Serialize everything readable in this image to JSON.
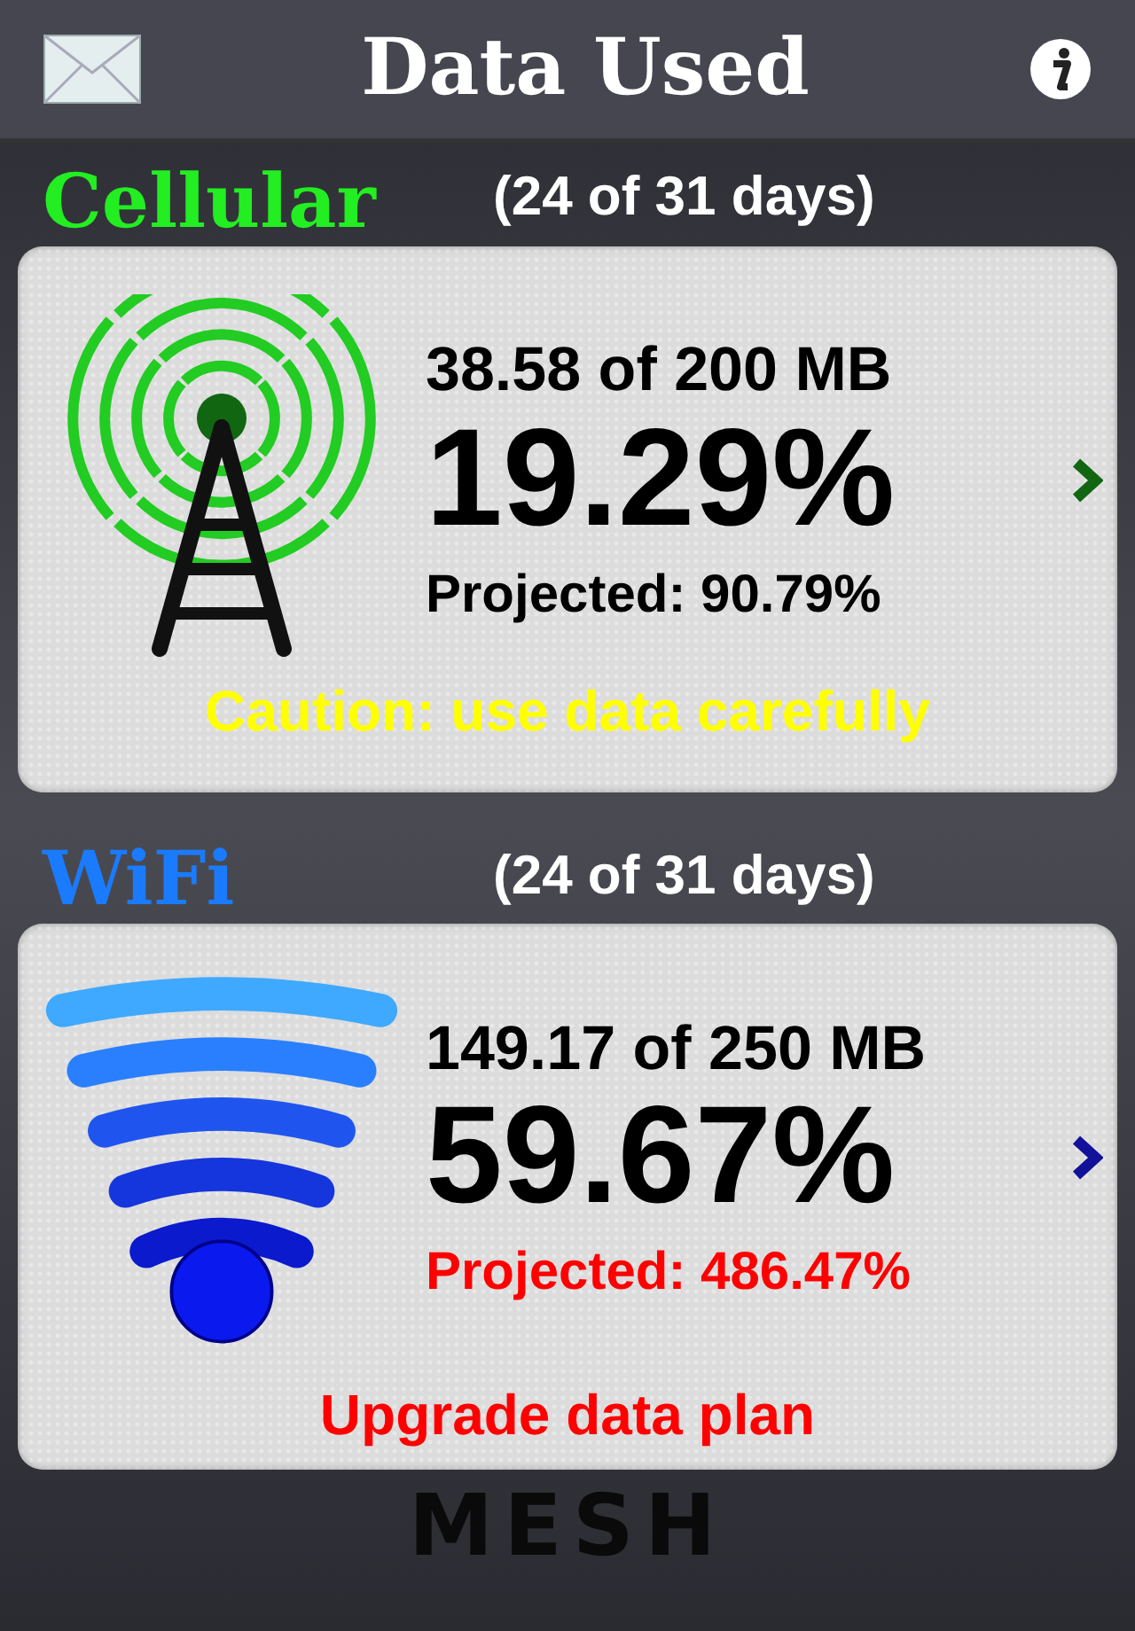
{
  "header": {
    "title": "Data Used"
  },
  "sections": [
    {
      "kind": "cellular",
      "name": "Cellular",
      "color": "#22ee22",
      "days": "(24 of 31 days)",
      "usage": "38.58 of 200 MB",
      "percent": "19.29%",
      "projected": "Projected: 90.79%",
      "message": "Caution: use data carefully",
      "over_limit": false
    },
    {
      "kind": "wifi",
      "name": "WiFi",
      "color": "#1a7bff",
      "days": "(24 of 31 days)",
      "usage": "149.17 of 250 MB",
      "percent": "59.67%",
      "projected": "Projected: 486.47%",
      "message": "Upgrade data plan",
      "over_limit": true
    }
  ],
  "footer": {
    "logo": "MESH"
  }
}
